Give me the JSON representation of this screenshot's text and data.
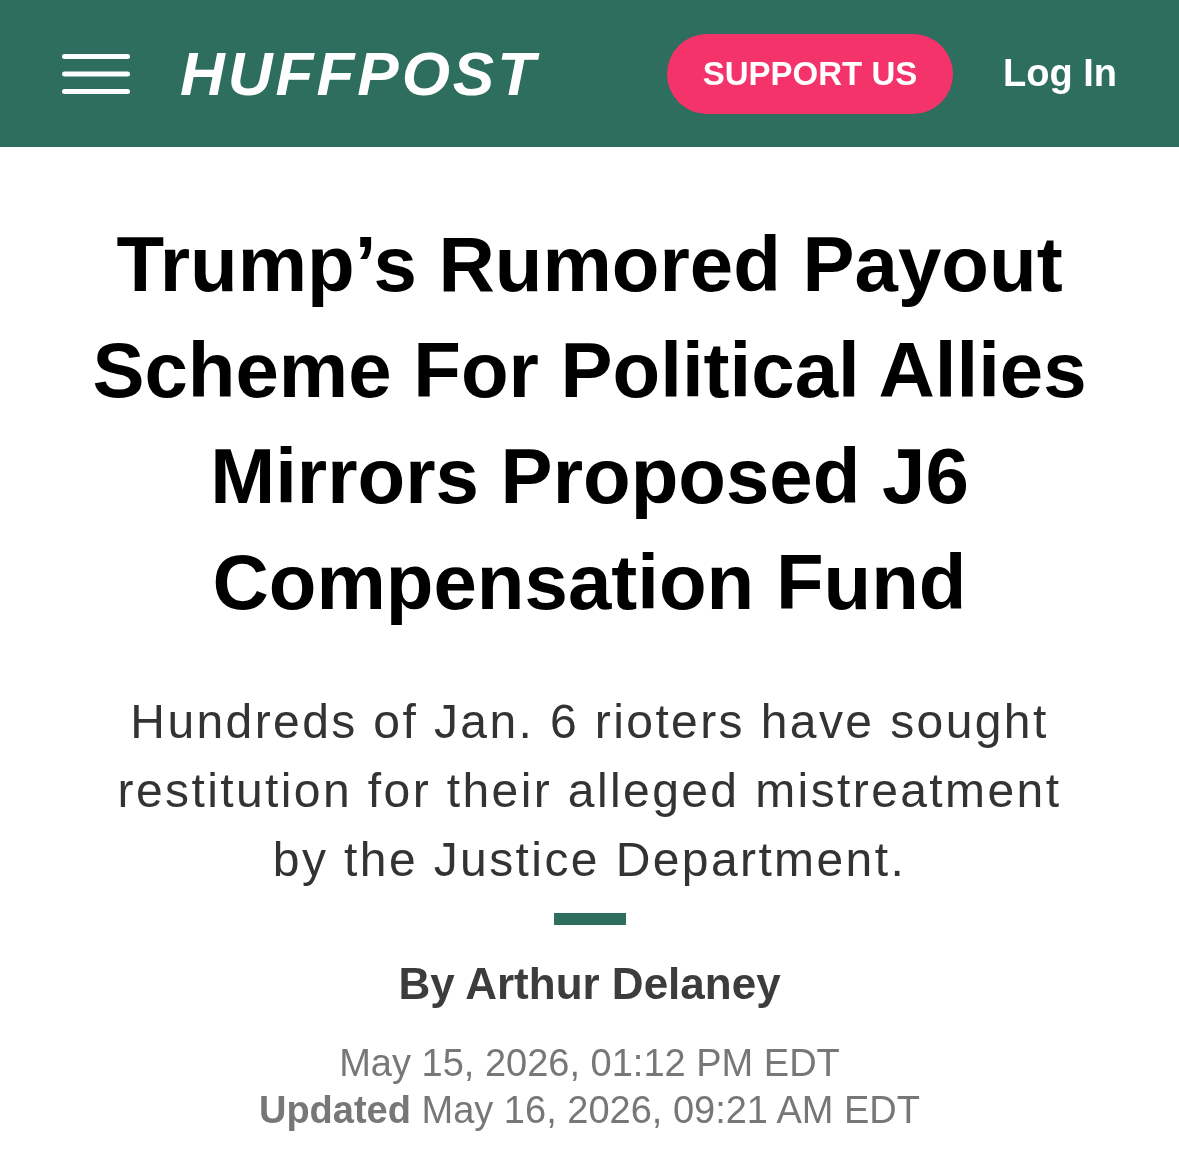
{
  "header": {
    "logo": "HUFFPOST",
    "support_button": "SUPPORT US",
    "login_link": "Log In"
  },
  "article": {
    "headline": "Trump’s Rumored Payout Scheme For Political Allies Mirrors Proposed J6 Compensation Fund",
    "subheadline": "Hundreds of Jan. 6 rioters have sought restitution for their alleged mistreatment by the Justice Department.",
    "byline": "By Arthur Delaney",
    "published": "May 15, 2026, 01:12 PM EDT",
    "updated": "**Updated** May 16, 2026, 09:21 AM EDT"
  }
}
